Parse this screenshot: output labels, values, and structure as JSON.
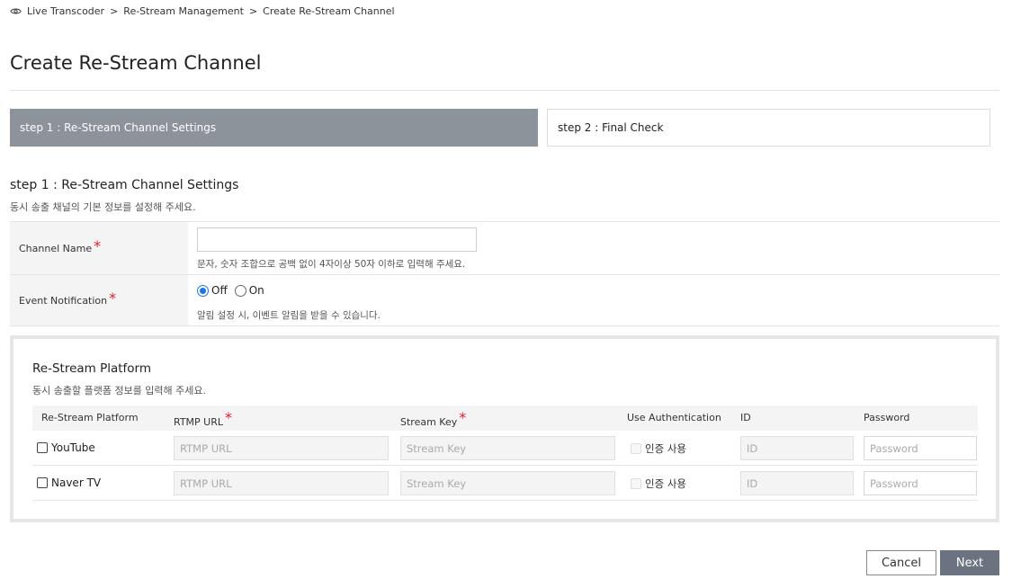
{
  "breadcrumb": {
    "icon": "eye-icon",
    "items": [
      "Live Transcoder",
      "Re-Stream Management",
      "Create Re-Stream Channel"
    ],
    "separator": ">"
  },
  "page_title": "Create Re-Stream Channel",
  "steps": [
    {
      "label": "step 1 : Re-Stream Channel Settings",
      "active": true
    },
    {
      "label": "step 2 : Final Check",
      "active": false
    }
  ],
  "section": {
    "title": "step 1 : Re-Stream Channel Settings",
    "description": "동시 송출 채널의 기본 정보를 설정해 주세요."
  },
  "form": {
    "channel_name": {
      "label": "Channel Name",
      "required_mark": "*",
      "value": "",
      "hint": "문자, 숫자 조합으로 공백 없이 4자이상 50자 이하로 입력해 주세요."
    },
    "event_notification": {
      "label": "Event Notification",
      "required_mark": "*",
      "options": [
        "Off",
        "On"
      ],
      "selected": "Off",
      "hint": "알림 설정 시, 이벤트 알림을 받을 수 있습니다."
    }
  },
  "platform": {
    "title": "Re-Stream Platform",
    "description": "동시 송출할 플랫폼 정보를 입력해 주세요.",
    "headers": {
      "platform": "Re-Stream Platform",
      "rtmp_url": "RTMP URL",
      "stream_key": "Stream Key",
      "use_auth": "Use Authentication",
      "id": "ID",
      "password": "Password",
      "required_mark": "*"
    },
    "rows": [
      {
        "name": "YouTube",
        "checked": false,
        "rtmp_placeholder": "RTMP URL",
        "key_placeholder": "Stream Key",
        "auth_label": "인증 사용",
        "id_placeholder": "ID",
        "password_placeholder": "Password"
      },
      {
        "name": "Naver TV",
        "checked": false,
        "rtmp_placeholder": "RTMP URL",
        "key_placeholder": "Stream Key",
        "auth_label": "인증 사용",
        "id_placeholder": "ID",
        "password_placeholder": "Password"
      }
    ]
  },
  "buttons": {
    "cancel": "Cancel",
    "next": "Next"
  },
  "colors": {
    "active_step": "#8d939b",
    "required": "#e0202a",
    "primary_button": "#6b7280",
    "radio_accent": "#1a73e8"
  }
}
